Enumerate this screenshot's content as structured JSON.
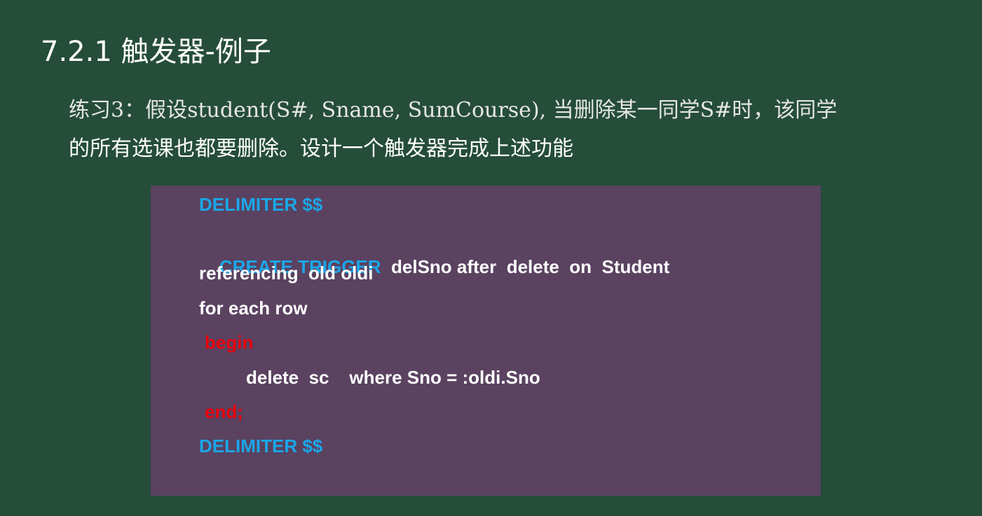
{
  "slide": {
    "title": "7.2.1 触发器-例子",
    "exercise_line1": "练习3：假设student(S#, Sname, SumCourse), 当删除某一同学S#时，该同学",
    "exercise_line2": "的所有选课也都要删除。设计一个触发器完成上述功能"
  },
  "code": {
    "delimiter_start": "DELIMITER $$",
    "create_trigger_keyword": "CREATE TRIGGER",
    "create_trigger_rest": "delSno after  delete  on  Student",
    "referencing": "referencing  old oldi",
    "for_each_row": "for each row",
    "begin": "begin",
    "delete_statement": "delete  sc    where Sno = :oldi.Sno",
    "end": "end;",
    "delimiter_end": "DELIMITER $$"
  },
  "colors": {
    "background": "#254d3a",
    "code_panel": "#5a4260",
    "keyword_blue": "#1aa7e8",
    "keyword_red": "#e8000b",
    "text": "#ffffff"
  }
}
